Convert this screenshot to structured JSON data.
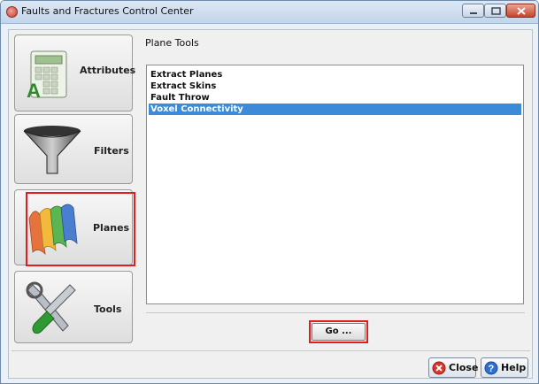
{
  "window": {
    "title": "Faults and Fractures Control Center"
  },
  "sidebar": {
    "items": [
      {
        "label": "Attributes",
        "icon": "calculator-icon",
        "selected": false
      },
      {
        "label": "Filters",
        "icon": "funnel-icon",
        "selected": false
      },
      {
        "label": "Planes",
        "icon": "planes-icon",
        "selected": true
      },
      {
        "label": "Tools",
        "icon": "tools-icon",
        "selected": false
      }
    ]
  },
  "main": {
    "section_title": "Plane Tools",
    "list": [
      {
        "label": "Extract Planes",
        "selected": false
      },
      {
        "label": "Extract Skins",
        "selected": false
      },
      {
        "label": "Fault Throw",
        "selected": false
      },
      {
        "label": "Voxel Connectivity",
        "selected": true
      }
    ],
    "go_label": "Go ..."
  },
  "footer": {
    "close_label": "Close",
    "help_label": "Help"
  },
  "colors": {
    "selection": "#3b8bd9",
    "highlight_outline": "#e11e1e",
    "titlebar": "#c3d5ea"
  }
}
